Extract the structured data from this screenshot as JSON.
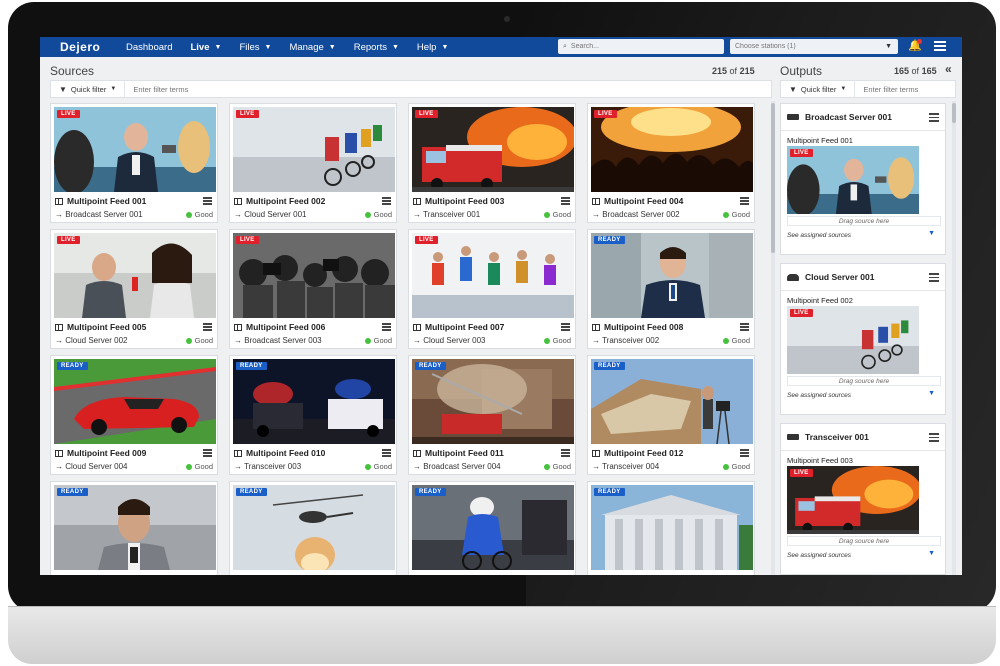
{
  "nav": {
    "logo": "Dejero",
    "items": [
      {
        "label": "Dashboard",
        "dropdown": false,
        "active": false
      },
      {
        "label": "Live",
        "dropdown": true,
        "active": true
      },
      {
        "label": "Files",
        "dropdown": true,
        "active": false
      },
      {
        "label": "Manage",
        "dropdown": true,
        "active": false
      },
      {
        "label": "Reports",
        "dropdown": true,
        "active": false
      },
      {
        "label": "Help",
        "dropdown": true,
        "active": false
      }
    ],
    "search_placeholder": "Search...",
    "stations_placeholder": "Choose stations (1)"
  },
  "sources": {
    "title": "Sources",
    "count_shown": "215",
    "count_of": "of",
    "count_total": "215",
    "quick_filter_label": "Quick filter",
    "filter_placeholder": "Enter filter terms",
    "cards": [
      {
        "title": "Multipoint Feed 001",
        "dest": "→ Broadcast Server 001",
        "status": "Good",
        "badge": "LIVE",
        "badge_type": "live",
        "scene": "interview"
      },
      {
        "title": "Multipoint Feed 002",
        "dest": "→ Cloud Server 001",
        "status": "Good",
        "badge": "LIVE",
        "badge_type": "live",
        "scene": "cycling"
      },
      {
        "title": "Multipoint Feed 003",
        "dest": "→ Transceiver 001",
        "status": "Good",
        "badge": "LIVE",
        "badge_type": "live",
        "scene": "firetruck"
      },
      {
        "title": "Multipoint Feed 004",
        "dest": "→ Broadcast Server 002",
        "status": "Good",
        "badge": "LIVE",
        "badge_type": "live",
        "scene": "concert"
      },
      {
        "title": "Multipoint Feed 005",
        "dest": "→ Cloud Server 002",
        "status": "Good",
        "badge": "LIVE",
        "badge_type": "live",
        "scene": "reporter"
      },
      {
        "title": "Multipoint Feed 006",
        "dest": "→ Broadcast Server 003",
        "status": "Good",
        "badge": "LIVE",
        "badge_type": "live",
        "scene": "press"
      },
      {
        "title": "Multipoint Feed 007",
        "dest": "→ Cloud Server 003",
        "status": "Good",
        "badge": "LIVE",
        "badge_type": "live",
        "scene": "running"
      },
      {
        "title": "Multipoint Feed 008",
        "dest": "→ Transceiver 002",
        "status": "Good",
        "badge": "READY",
        "badge_type": "ready",
        "scene": "anchor"
      },
      {
        "title": "Multipoint Feed 009",
        "dest": "→ Cloud Server 004",
        "status": "Good",
        "badge": "READY",
        "badge_type": "ready",
        "scene": "racecar"
      },
      {
        "title": "Multipoint Feed 010",
        "dest": "→ Transceiver 003",
        "status": "Good",
        "badge": "READY",
        "badge_type": "ready",
        "scene": "police"
      },
      {
        "title": "Multipoint Feed 011",
        "dest": "→ Broadcast Server 004",
        "status": "Good",
        "badge": "READY",
        "badge_type": "ready",
        "scene": "fire"
      },
      {
        "title": "Multipoint Feed 012",
        "dest": "→ Transceiver 004",
        "status": "Good",
        "badge": "READY",
        "badge_type": "ready",
        "scene": "storm"
      },
      {
        "title": "",
        "dest": "",
        "status": "",
        "badge": "READY",
        "badge_type": "ready",
        "scene": "man"
      },
      {
        "title": "",
        "dest": "",
        "status": "",
        "badge": "READY",
        "badge_type": "ready",
        "scene": "helicopter"
      },
      {
        "title": "",
        "dest": "",
        "status": "",
        "badge": "READY",
        "badge_type": "ready",
        "scene": "cyclist"
      },
      {
        "title": "",
        "dest": "",
        "status": "",
        "badge": "READY",
        "badge_type": "ready",
        "scene": "building"
      }
    ]
  },
  "outputs": {
    "title": "Outputs",
    "count_shown": "165",
    "count_of": "of",
    "count_total": "165",
    "quick_filter_label": "Quick filter",
    "filter_placeholder": "Enter filter terms",
    "cards": [
      {
        "name": "Broadcast Server 001",
        "icon": "server-icon",
        "feed": "Multipoint Feed 001",
        "badge": "LIVE",
        "scene": "interview",
        "drag_text": "Drag source here",
        "assigned_text": "See assigned sources"
      },
      {
        "name": "Cloud Server 001",
        "icon": "cloud-icon",
        "feed": "Multipoint Feed 002",
        "badge": "LIVE",
        "scene": "cycling",
        "drag_text": "Drag source here",
        "assigned_text": "See assigned sources"
      },
      {
        "name": "Transceiver 001",
        "icon": "transceiver-icon",
        "feed": "Multipoint Feed 003",
        "badge": "LIVE",
        "scene": "firetruck",
        "drag_text": "Drag source here",
        "assigned_text": "See assigned sources"
      }
    ]
  },
  "colors": {
    "nav_bg": "#124a9b",
    "live_badge": "#e0202a",
    "ready_badge": "#1a5fc8",
    "status_good": "#46c23c",
    "screen_bg": "#eef0f2"
  }
}
